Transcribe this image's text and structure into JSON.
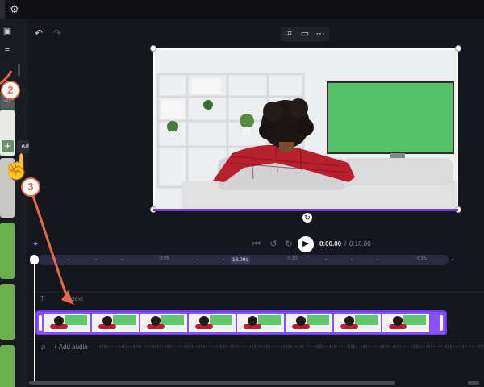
{
  "toolbar": {
    "tooltip_add": "Add to timeline"
  },
  "steps": [
    "2",
    "3"
  ],
  "playback": {
    "current_time": "0:00.00",
    "separator": "/",
    "total_time": "0:16.00"
  },
  "ruler": {
    "ticks": [
      "0:05",
      "0:10",
      "0:15"
    ],
    "marker": "16.00s"
  },
  "tracks": {
    "text_label": "text",
    "audio_label": "+ Add audio"
  },
  "colors": {
    "accent": "#6d3cf0",
    "clip": "#8a4fff",
    "annotation": "#e46a4a",
    "green_screen": "#5fc86a"
  }
}
